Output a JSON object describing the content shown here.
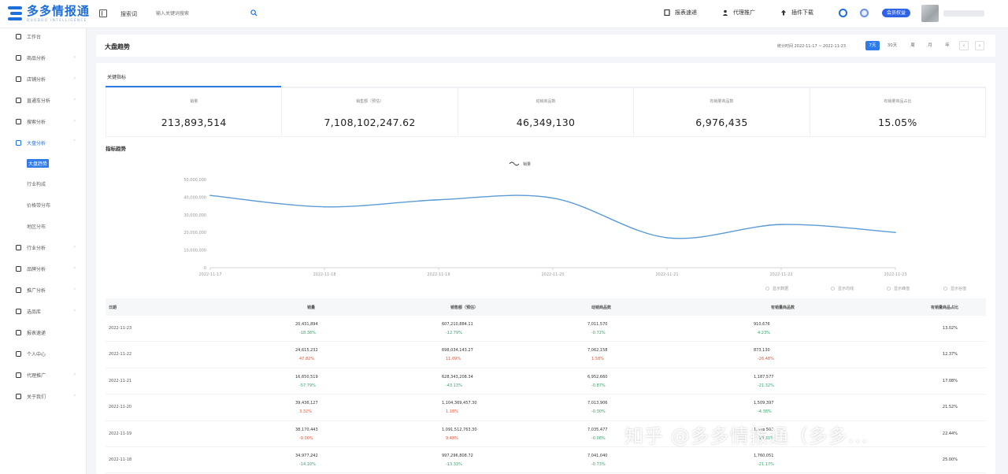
{
  "app": {
    "name": "多多情报通",
    "tagline": "DUODUO INTELLIGENCE"
  },
  "topbar": {
    "search_label": "搜索词",
    "search_placeholder": "输入关键词搜索",
    "actions": [
      "报表速递",
      "代理推广",
      "插件下载"
    ],
    "badge": "会员权益"
  },
  "sidebar": {
    "items": [
      "工作台",
      "商品分析",
      "店铺分析",
      "直通车分析",
      "搜索分析",
      "大盘分析",
      "行业分析",
      "品牌分析",
      "推广分析",
      "选品库",
      "报表速递",
      "个人中心",
      "代理推广",
      "关于我们"
    ],
    "sub_items": [
      "大盘趋势",
      "行业构成",
      "价格带分布",
      "地区分布"
    ]
  },
  "header": {
    "title": "大盘趋势",
    "date_range": "统计时间 2022-11-17 ~ 2022-11-23",
    "periods": [
      "7天",
      "30天",
      "周",
      "月",
      "年"
    ]
  },
  "main": {
    "tab": "关键指标",
    "section_title": "指标趋势"
  },
  "kpis": [
    {
      "label": "销量",
      "value": "213,893,514"
    },
    {
      "label": "销售额（预估）",
      "value": "7,108,102,247.62"
    },
    {
      "label": "动销商品数",
      "value": "46,349,130"
    },
    {
      "label": "有销量商品数",
      "value": "6,976,435"
    },
    {
      "label": "有销量商品占比",
      "value": "15.05%"
    }
  ],
  "chart_data": {
    "type": "line",
    "legend": "销量",
    "x": [
      "2022-11-17",
      "2022-11-18",
      "2022-11-19",
      "2022-11-20",
      "2022-11-21",
      "2022-11-22",
      "2022-11-23"
    ],
    "series": [
      {
        "name": "销量",
        "values": [
          41000000,
          34500000,
          38500000,
          39500000,
          17000000,
          24500000,
          20000000
        ]
      }
    ],
    "yticks": [
      "0",
      "10,000,000",
      "20,000,000",
      "30,000,000",
      "40,000,000",
      "50,000,000"
    ],
    "ylim": [
      0,
      50000000
    ],
    "color": "#5b9bd5",
    "options": [
      "显示数据",
      "显示均线",
      "显示峰值",
      "显示谷值"
    ]
  },
  "table": {
    "headers": [
      "日期",
      "销量",
      "销售额（预估）",
      "动销商品数",
      "有销量商品数",
      "有销量商品占比"
    ],
    "rows": [
      {
        "date": "2022-11-23",
        "cells": [
          [
            "20,431,894",
            "-18.38%",
            "up"
          ],
          [
            "607,210,884.11",
            "-12.79%",
            "up"
          ],
          [
            "7,011,570",
            "-0.72%",
            "up"
          ],
          [
            "910,676",
            "4.23%",
            "up"
          ]
        ],
        "ratio": "13.02%"
      },
      {
        "date": "2022-11-22",
        "cells": [
          [
            "24,615,232",
            "47.82%",
            "down"
          ],
          [
            "698,034,143.27",
            "11.09%",
            "down"
          ],
          [
            "7,062,158",
            "1.58%",
            "down"
          ],
          [
            "873,130",
            "-26.48%",
            "down"
          ]
        ],
        "ratio": "12.37%"
      },
      {
        "date": "2022-11-21",
        "cells": [
          [
            "16,650,519",
            "-57.79%",
            "up"
          ],
          [
            "628,343,208.34",
            "-43.13%",
            "up"
          ],
          [
            "6,952,660",
            "-0.87%",
            "up"
          ],
          [
            "1,187,577",
            "-21.32%",
            "up"
          ]
        ],
        "ratio": "17.08%"
      },
      {
        "date": "2022-11-20",
        "cells": [
          [
            "39,436,127",
            "3.32%",
            "down"
          ],
          [
            "1,104,369,457.30",
            "1.18%",
            "down"
          ],
          [
            "7,013,906",
            "-0.30%",
            "up"
          ],
          [
            "1,509,397",
            "-4.38%",
            "up"
          ]
        ],
        "ratio": "21.52%"
      },
      {
        "date": "2022-11-19",
        "cells": [
          [
            "38,170,443",
            "-9.00%",
            "down"
          ],
          [
            "1,091,512,763.30",
            "9.48%",
            "down"
          ],
          [
            "7,035,477",
            "-0.08%",
            "up"
          ],
          [
            "1,578,505",
            "-10.31%",
            "up"
          ]
        ],
        "ratio": "22.44%"
      },
      {
        "date": "2022-11-18",
        "cells": [
          [
            "34,977,242",
            "-14.10%",
            "up"
          ],
          [
            "997,296,808.72",
            "-13.33%",
            "up"
          ],
          [
            "7,041,040",
            "-0.73%",
            "up"
          ],
          [
            "1,760,051",
            "-21.17%",
            "up"
          ]
        ],
        "ratio": "25.00%"
      }
    ]
  },
  "watermark": "知乎 @多多情报通（多多..."
}
